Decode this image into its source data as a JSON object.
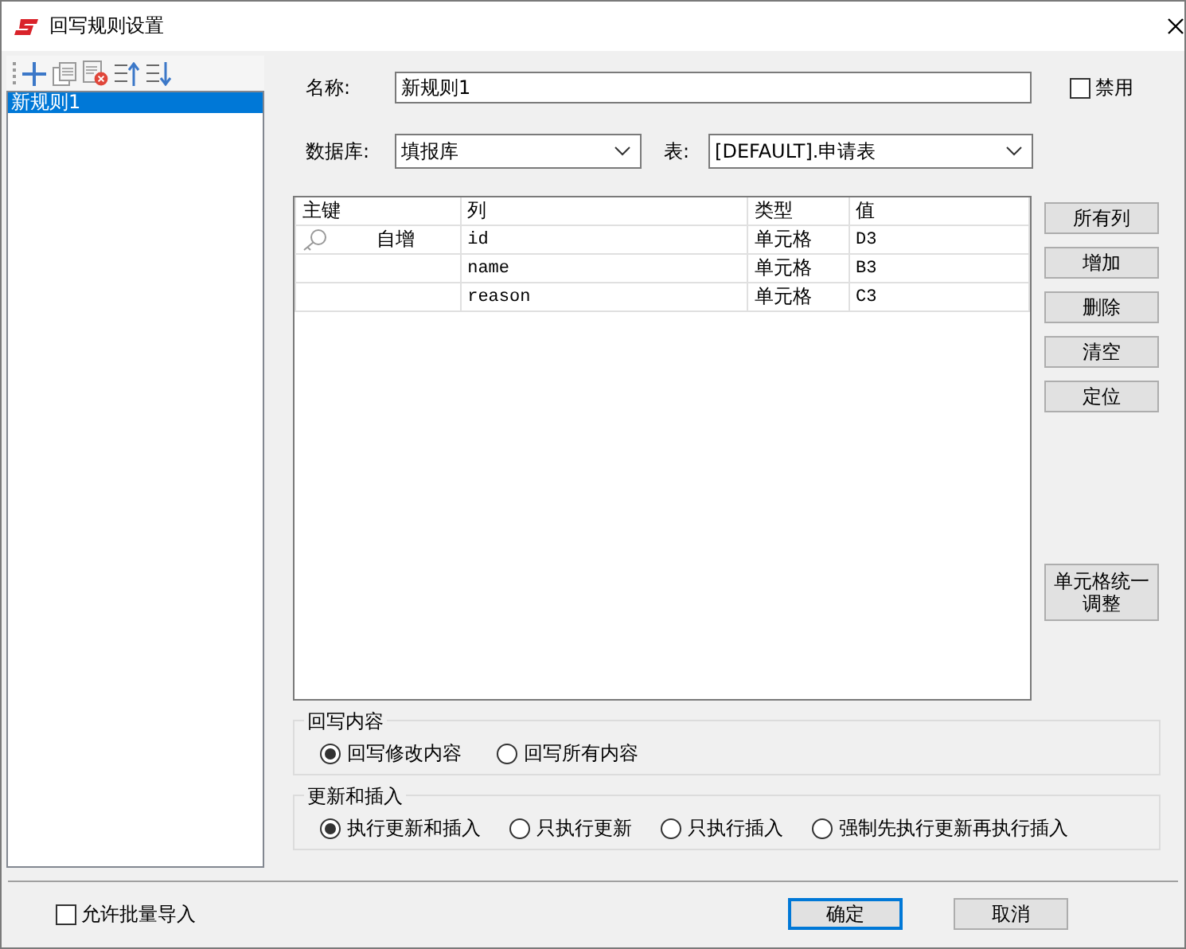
{
  "window": {
    "title": "回写规则设置"
  },
  "rules": [
    {
      "label": "新规则1",
      "selected": true
    }
  ],
  "name": {
    "label": "名称:",
    "value": "新规则1"
  },
  "disabled": {
    "label": "禁用",
    "checked": false
  },
  "database": {
    "label": "数据库:",
    "value": "填报库"
  },
  "table_select": {
    "label": "表:",
    "value": "[DEFAULT].申请表"
  },
  "table": {
    "columns": [
      "主键",
      "列",
      "类型",
      "值"
    ],
    "rows": [
      {
        "primary_key": true,
        "key": "自增",
        "column": "id",
        "type": "单元格",
        "value": "D3"
      },
      {
        "primary_key": false,
        "column": "name",
        "type": "单元格",
        "value": "B3"
      },
      {
        "primary_key": false,
        "column": "reason",
        "type": "单元格",
        "value": "C3"
      }
    ]
  },
  "side_buttons": [
    "所有列",
    "增加",
    "删除",
    "清空",
    "定位"
  ],
  "adjust_button": "单元格统一调整",
  "writeback": {
    "title": "回写内容",
    "options": [
      {
        "label": "回写修改内容",
        "selected": true
      },
      {
        "label": "回写所有内容",
        "selected": false
      }
    ]
  },
  "update_insert": {
    "title": "更新和插入",
    "options": [
      {
        "label": "执行更新和插入",
        "selected": true
      },
      {
        "label": "只执行更新",
        "selected": false
      },
      {
        "label": "只执行插入",
        "selected": false
      },
      {
        "label": "强制先执行更新再执行插入",
        "selected": false
      }
    ]
  },
  "batch_import": {
    "label": "允许批量导入",
    "checked": false
  },
  "buttons": [
    {
      "label": "确定",
      "default": true
    },
    {
      "label": "取消",
      "default": false
    }
  ]
}
